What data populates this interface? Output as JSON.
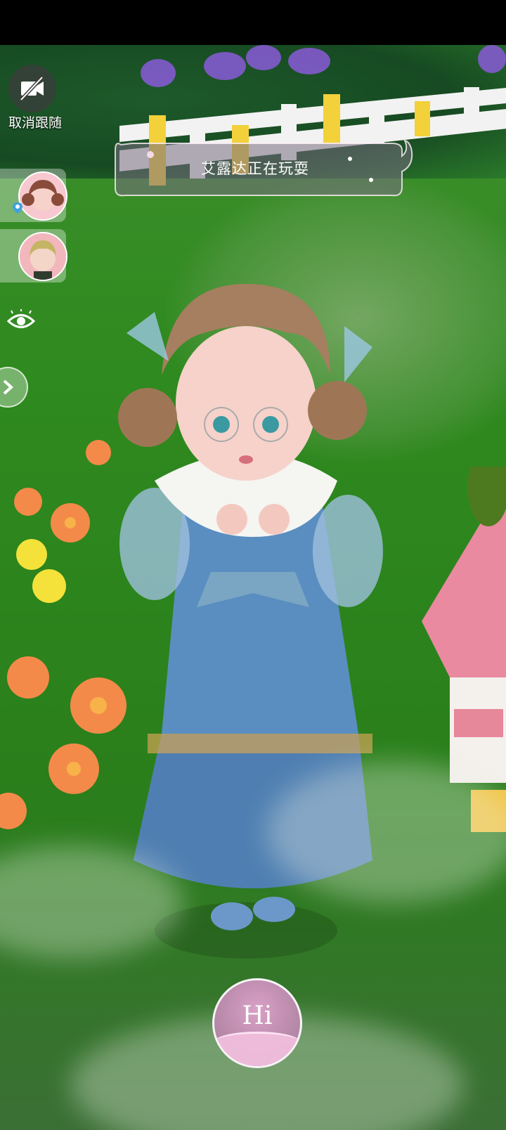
{
  "hud": {
    "follow_label": "取消跟随",
    "speech_bubble": "艾露达正在玩耍",
    "hi_label": "Hi"
  },
  "icons": {
    "follow": "no-camera-icon",
    "location": "location-pin-icon",
    "visibility": "eye-icon",
    "expand": "chevron-right-icon"
  },
  "colors": {
    "grass": "#2f8a1f",
    "fence_white": "#f2f2f2",
    "fence_yellow": "#f2d13a",
    "hi_pink": "#f0bedc"
  }
}
